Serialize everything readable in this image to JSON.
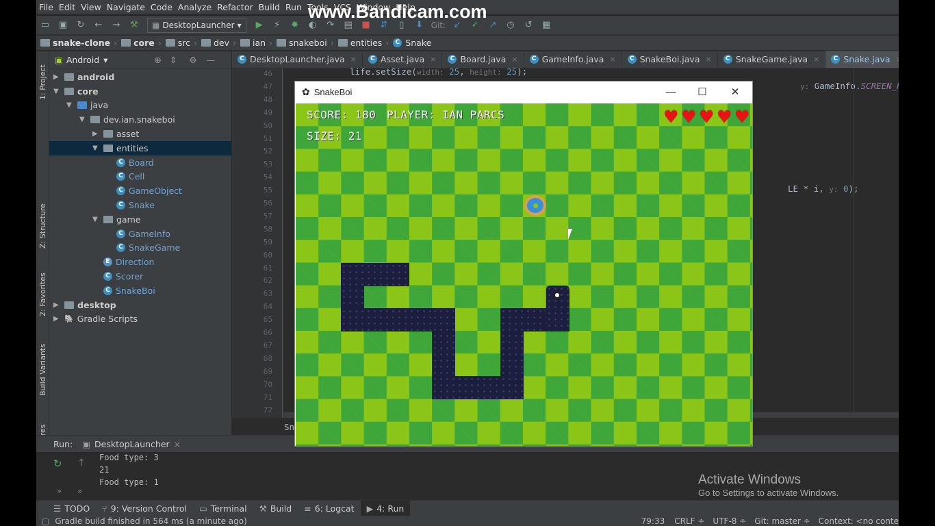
{
  "menubar": [
    "File",
    "Edit",
    "View",
    "Navigate",
    "Code",
    "Analyze",
    "Refactor",
    "Build",
    "Run",
    "Tools",
    "VCS",
    "Window",
    "Help"
  ],
  "watermark": "www.Bandicam.com",
  "toolbar": {
    "run_config": "DesktopLauncher",
    "git_label": "Git:"
  },
  "breadcrumbs": [
    "snake-clone",
    "core",
    "src",
    "dev",
    "ian",
    "snakeboi",
    "entities",
    "Snake"
  ],
  "left_strip": {
    "project": "1: Project",
    "structure": "Z: Structure",
    "favorites": "2: Favorites",
    "build_variants": "Build Variants",
    "layout_captures": "Layout Captures"
  },
  "project_panel": {
    "view": "Android",
    "tree": [
      {
        "label": "android",
        "depth": 0,
        "arrow": "▶",
        "type": "folder"
      },
      {
        "label": "core",
        "depth": 0,
        "arrow": "▼",
        "type": "folder"
      },
      {
        "label": "java",
        "depth": 1,
        "arrow": "▼",
        "type": "folder-blue"
      },
      {
        "label": "dev.ian.snakeboi",
        "depth": 2,
        "arrow": "▼",
        "type": "folder"
      },
      {
        "label": "asset",
        "depth": 3,
        "arrow": "▶",
        "type": "folder"
      },
      {
        "label": "entities",
        "depth": 3,
        "arrow": "▼",
        "type": "folder",
        "selected": true
      },
      {
        "label": "Board",
        "depth": 4,
        "arrow": "",
        "type": "class"
      },
      {
        "label": "Cell",
        "depth": 4,
        "arrow": "",
        "type": "class"
      },
      {
        "label": "GameObject",
        "depth": 4,
        "arrow": "",
        "type": "class"
      },
      {
        "label": "Snake",
        "depth": 4,
        "arrow": "",
        "type": "class"
      },
      {
        "label": "game",
        "depth": 3,
        "arrow": "▼",
        "type": "folder"
      },
      {
        "label": "GameInfo",
        "depth": 4,
        "arrow": "",
        "type": "class"
      },
      {
        "label": "SnakeGame",
        "depth": 4,
        "arrow": "",
        "type": "class"
      },
      {
        "label": "Direction",
        "depth": 3,
        "arrow": "",
        "type": "enum"
      },
      {
        "label": "Scorer",
        "depth": 3,
        "arrow": "",
        "type": "class"
      },
      {
        "label": "SnakeBoi",
        "depth": 3,
        "arrow": "",
        "type": "class"
      },
      {
        "label": "desktop",
        "depth": 0,
        "arrow": "▶",
        "type": "folder"
      },
      {
        "label": "Gradle Scripts",
        "depth": 0,
        "arrow": "▶",
        "type": "gradle"
      }
    ]
  },
  "editor_tabs": [
    {
      "label": "DesktopLauncher.java",
      "active": false
    },
    {
      "label": "Asset.java",
      "active": false
    },
    {
      "label": "Board.java",
      "active": false
    },
    {
      "label": "GameInfo.java",
      "active": false
    },
    {
      "label": "SnakeBoi.java",
      "active": false
    },
    {
      "label": "SnakeGame.java",
      "active": false
    },
    {
      "label": "Snake.java",
      "active": true
    }
  ],
  "line_numbers": [
    "46",
    "47",
    "48",
    "49",
    "50",
    "51",
    "52",
    "53",
    "54",
    "55",
    "56",
    "57",
    "58",
    "59",
    "60",
    "61",
    "62",
    "63",
    "64",
    "65",
    "66",
    "67",
    "68",
    "69",
    "70",
    "71",
    "72"
  ],
  "code": {
    "line45_pre": "life.setSize(",
    "line45_h1": "width:",
    "line45_v1": "25",
    "line45_h2": "height:",
    "line45_v2": "25",
    "line45_post": ");",
    "line47_h": "y:",
    "line47_cls": "GameInfo.",
    "line47_field": "SCREEN_HEIGH",
    "line55_pre": "LE * i, ",
    "line55_h": "y:",
    "line55_v": "0",
    "line55_post": ");",
    "bottom_stub": "Sn"
  },
  "game_window": {
    "title": "SnakeBoi",
    "score": "SCORE: 180",
    "player": "PLAYER: IAN PARCS",
    "size": "SIZE: 21",
    "lives": 5
  },
  "run_panel": {
    "label": "Run:",
    "tab": "DesktopLauncher",
    "output": [
      "Food type: 3",
      "21",
      "Food type: 1"
    ]
  },
  "tool_windows": [
    {
      "label": "TODO",
      "active": false
    },
    {
      "label": "9: Version Control",
      "active": false
    },
    {
      "label": "Terminal",
      "active": false
    },
    {
      "label": "Build",
      "active": false
    },
    {
      "label": "6: Logcat",
      "active": false
    },
    {
      "label": "4: Run",
      "active": true
    }
  ],
  "status": {
    "message": "Gradle build finished in 564 ms (a minute ago)",
    "position": "79:33",
    "line_sep": "CRLF ÷",
    "encoding": "UTF-8 ÷",
    "git": "Git: master ÷",
    "context": "Context: <no conte"
  },
  "activate_windows": {
    "title": "Activate Windows",
    "subtitle": "Go to Settings to activate Windows."
  }
}
